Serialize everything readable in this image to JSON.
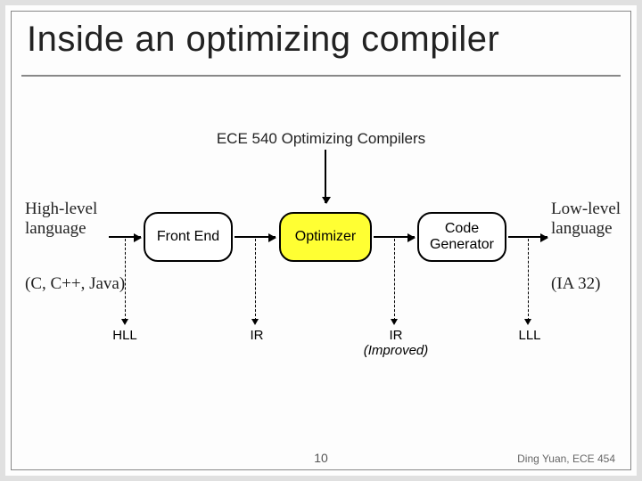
{
  "title": "Inside an optimizing compiler",
  "subtitle": "ECE 540  Optimizing Compilers",
  "left": {
    "label_line1": "High-level",
    "label_line2": "language",
    "sub": "(C, C++, Java)"
  },
  "right": {
    "label_line1": "Low-level",
    "label_line2": "language",
    "sub": "(IA 32)"
  },
  "boxes": {
    "front_end": "Front End",
    "optimizer": "Optimizer",
    "codegen_line1": "Code",
    "codegen_line2": "Generator"
  },
  "edge_labels": {
    "hll": "HLL",
    "ir": "IR",
    "ir_improved_line1": "IR",
    "ir_improved_line2": "(Improved)",
    "lll": "LLL"
  },
  "page_number": "10",
  "credit": "Ding Yuan, ECE 454"
}
